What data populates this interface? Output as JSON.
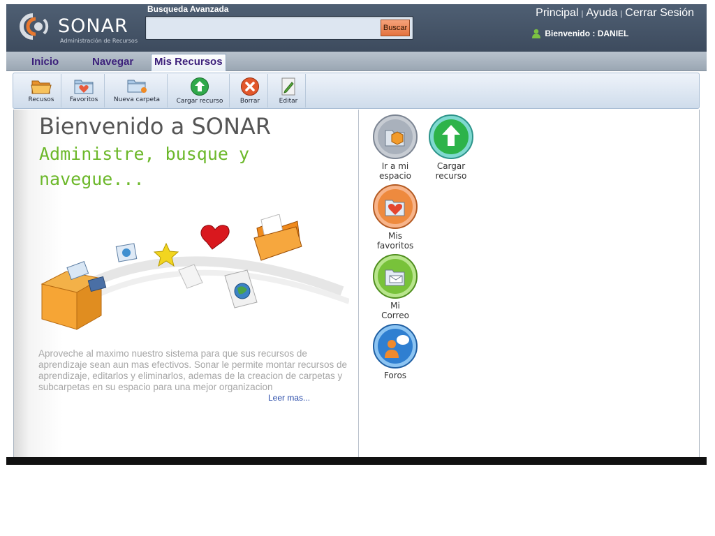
{
  "header": {
    "logo_text": "SONAR",
    "logo_subtitle": "Administración de Recursos",
    "advanced_search_label": "Busqueda Avanzada",
    "search_value": "",
    "search_button_label": "Buscar",
    "links": [
      "Principal",
      "Ayuda",
      "Cerrar Sesión"
    ],
    "welcome_prefix": "Bienvenido :",
    "username": "DANIEL"
  },
  "tabs": [
    {
      "label": "Inicio",
      "active": false
    },
    {
      "label": "Navegar",
      "active": false
    },
    {
      "label": "Mis Recursos",
      "active": true
    }
  ],
  "toolbar": [
    {
      "label": "Recusos",
      "icon": "folder-open-icon"
    },
    {
      "label": "Favoritos",
      "icon": "favorites-folder-icon"
    },
    {
      "label": "Nueva carpeta",
      "icon": "new-folder-icon"
    },
    {
      "label": "Cargar recurso",
      "icon": "upload-icon"
    },
    {
      "label": "Borrar",
      "icon": "delete-icon"
    },
    {
      "label": "Editar",
      "icon": "edit-icon"
    }
  ],
  "main": {
    "title": "Bienvenido a SONAR",
    "subtitle": "Administre, busque y navegue...",
    "description": "Aproveche al maximo nuestro sistema para que sus recursos de aprendizaje sean aun mas efectivos. Sonar le permite montar recursos de aprendizaje, editarlos y eliminarlos, ademas de la creacion de carpetas y subcarpetas en su espacio para una mejor organizacion",
    "read_more": "Leer mas..."
  },
  "shortcuts": [
    {
      "line1": "Ir a mi",
      "line2": "espacio",
      "icon": "my-space-icon"
    },
    {
      "line1": "Cargar",
      "line2": "recurso",
      "icon": "upload-icon"
    },
    {
      "line1": "Mis",
      "line2": "favoritos",
      "icon": "favorites-icon"
    },
    {
      "line1": "Mi",
      "line2": "Correo",
      "icon": "mail-icon"
    },
    {
      "line1": "Foros",
      "line2": "",
      "icon": "forum-icon"
    }
  ],
  "colors": {
    "header_bg": "#46556a",
    "accent_green": "#6cb82a",
    "tab_text": "#3b1f7a",
    "button_orange": "#e4733f"
  }
}
